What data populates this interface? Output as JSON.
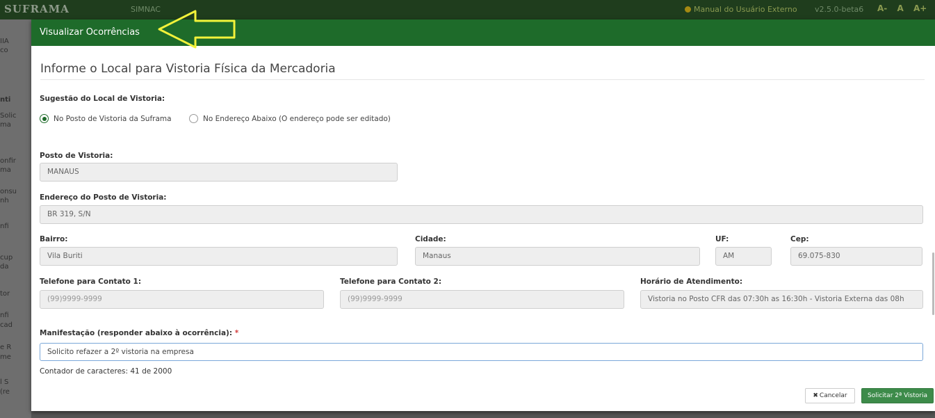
{
  "background_app": {
    "brand": "SUFRAMA",
    "system": "SIMNAC",
    "manual_link": "Manual do Usuário Externo",
    "version": "v2.5.0-beta6",
    "font_controls": [
      "A-",
      "A",
      "A+"
    ],
    "sidebar_fragments": [
      "IIA",
      "co",
      "nti",
      "Solic",
      "ma",
      "onfir",
      "ma",
      "onsu",
      "nh",
      "nfi",
      "cup",
      "da",
      "tor",
      "nfi",
      "cad",
      "e R",
      "me",
      "l S",
      "(re"
    ]
  },
  "modal": {
    "title": "Visualizar Ocorrências",
    "section_title": "Informe o Local para Vistoria Física da Mercadoria",
    "suggestion_label": "Sugestão do Local de Vistoria:",
    "radio_options": [
      {
        "label": "No Posto de Vistoria da Suframa",
        "selected": true
      },
      {
        "label": "No Endereço Abaixo (O endereço pode ser editado)",
        "selected": false
      }
    ],
    "posto": {
      "label": "Posto de Vistoria:",
      "value": "MANAUS"
    },
    "endereco": {
      "label": "Endereço do Posto de Vistoria:",
      "value": "BR 319, S/N"
    },
    "bairro": {
      "label": "Bairro:",
      "value": "Vila Buriti"
    },
    "cidade": {
      "label": "Cidade:",
      "value": "Manaus"
    },
    "uf": {
      "label": "UF:",
      "value": "AM"
    },
    "cep": {
      "label": "Cep:",
      "value": "69.075-830"
    },
    "telefone1": {
      "label": "Telefone para Contato 1:",
      "placeholder": "(99)9999-9999"
    },
    "telefone2": {
      "label": "Telefone para Contato 2:",
      "placeholder": "(99)9999-9999"
    },
    "horario": {
      "label": "Horário de Atendimento:",
      "value": "Vistoria no Posto CFR das 07:30h as 16:30h - Vistoria Externa das 08h"
    },
    "manifestacao": {
      "label": "Manifestação (responder abaixo à ocorrência):",
      "required_mark": "*",
      "value": "Solicito refazer a 2º vistoria na empresa"
    },
    "counter": "Contador de caracteres: 41 de 2000",
    "buttons": {
      "cancel": "Cancelar",
      "cancel_icon": "x-icon",
      "submit": "Solicitar 2ª Vistoria"
    }
  },
  "colors": {
    "header_green": "#1e6b2a",
    "submit_green": "#3d8b4a",
    "annotation_arrow": "#f2f23a"
  }
}
